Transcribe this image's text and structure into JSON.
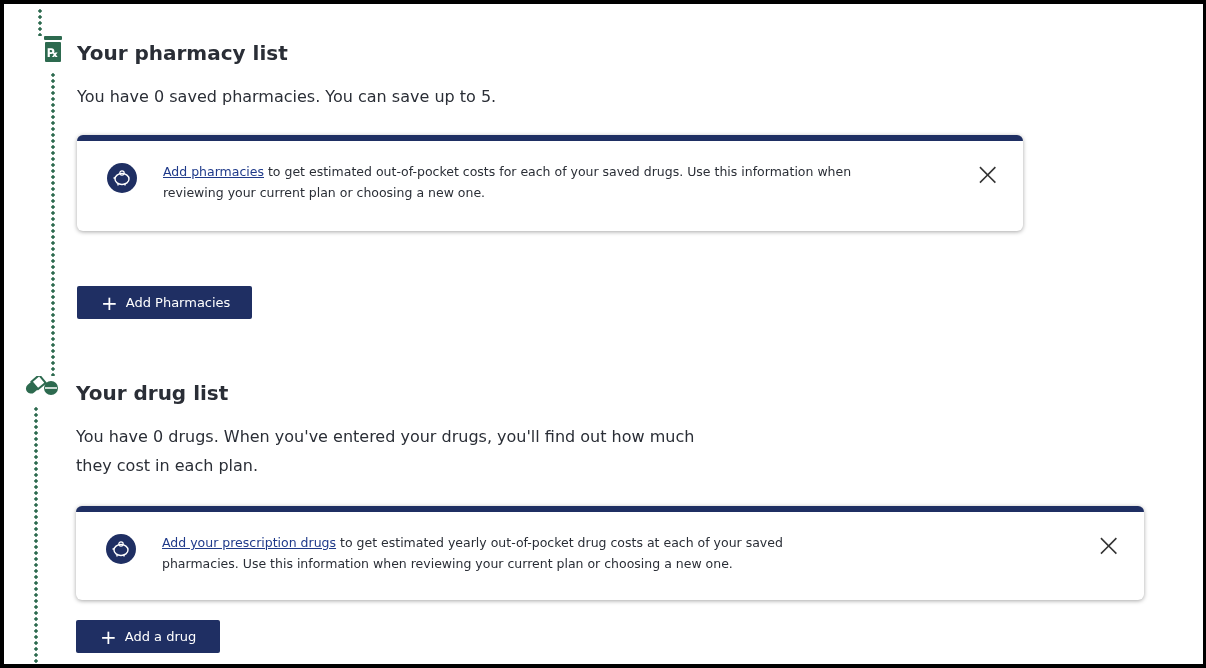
{
  "sections": [
    {
      "kind": "pharmacy",
      "icon_label": "℞",
      "title": "Your pharmacy list",
      "description": "You have 0 saved pharmacies. You can save up to 5.",
      "alert": {
        "link": "Add pharmacies",
        "text": "to get estimated out-of-pocket costs for each of your saved drugs. Use this information when reviewing your current plan or choosing a new one.",
        "close": "×"
      },
      "button": {
        "icon": "+",
        "label": "Add Pharmacies"
      }
    },
    {
      "kind": "drug",
      "title": "Your drug list",
      "description": "You have 0 drugs. When you've entered your drugs, you'll find out how much they cost in each plan.",
      "alert": {
        "link": "Add your prescription drugs",
        "text": "to get estimated yearly out-of-pocket drug costs at each of your saved pharmacies. Use this information when reviewing your current plan or choosing a new one.",
        "close": "×"
      },
      "button": {
        "icon": "+",
        "label": "Add a drug"
      }
    }
  ]
}
